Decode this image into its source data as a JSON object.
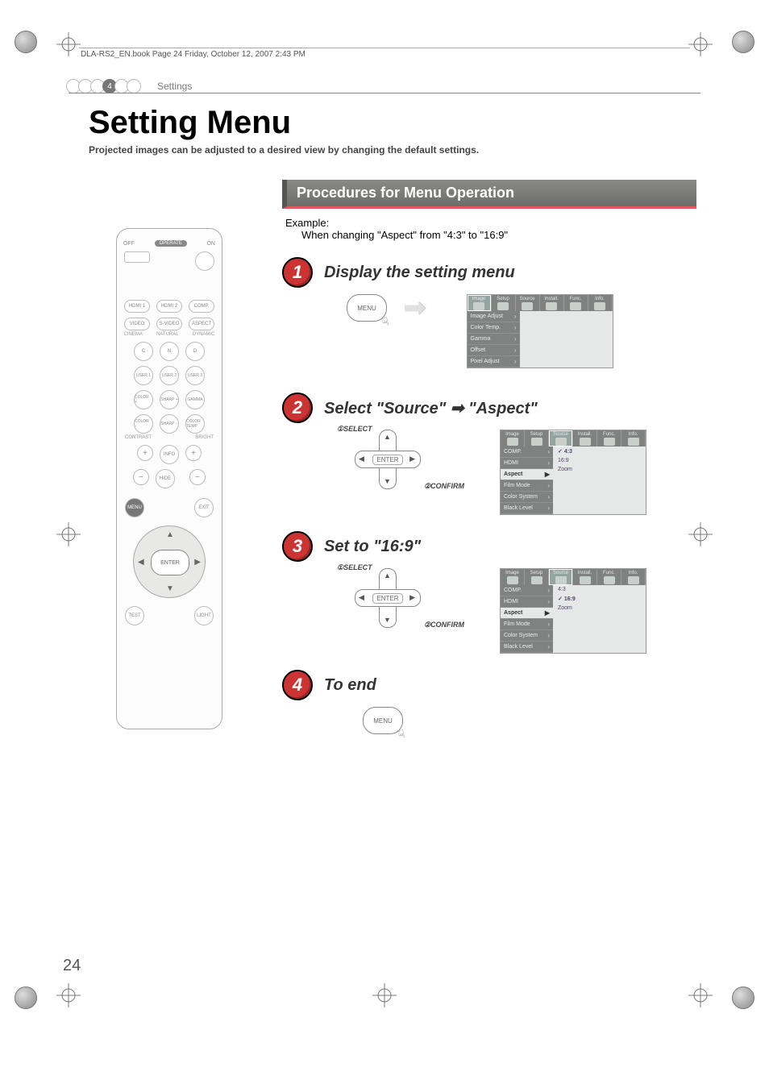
{
  "book_header": "DLA-RS2_EN.book  Page 24  Friday, October 12, 2007  2:43 PM",
  "breadcrumb": {
    "active_index": "4",
    "label": "Settings"
  },
  "title": "Setting Menu",
  "subtitle": "Projected images can be adjusted to a desired view by changing the default settings.",
  "section_header": "Procedures for Menu Operation",
  "example": {
    "label": "Example:",
    "desc": "When changing \"Aspect\" from \"4:3\" to \"16:9\""
  },
  "steps": [
    {
      "num": "1",
      "title": "Display the setting menu"
    },
    {
      "num": "2",
      "title": "Select \"Source\" ➡ \"Aspect\""
    },
    {
      "num": "3",
      "title": "Set to \"16:9\""
    },
    {
      "num": "4",
      "title": "To end"
    }
  ],
  "labels": {
    "menu": "MENU",
    "enter": "ENTER",
    "select": "①SELECT",
    "confirm": "②CONFIRM"
  },
  "remote": {
    "off": "OFF",
    "operate": "OPERATE",
    "on": "ON",
    "row1": [
      "HDMI 1",
      "HDMI 2",
      "COMP."
    ],
    "row2": [
      "VIDEO",
      "S-VIDEO",
      "ASPECT"
    ],
    "row2_labels": [
      "CINEMA",
      "NATURAL",
      "DYNAMIC"
    ],
    "row3": [
      "C",
      "N",
      "D"
    ],
    "row4": [
      "USER 1",
      "USER 2",
      "USER 3"
    ],
    "row5": [
      "COLOR +",
      "SHARP +",
      "GAMMA"
    ],
    "row6": [
      "COLOR −",
      "SHARP −",
      "COLOR TEMP"
    ],
    "contrast": "CONTRAST",
    "bright": "BRIGHT",
    "info": "INFO",
    "hide": "HIDE",
    "menu": "MENU",
    "exit": "EXIT",
    "enter": "ENTER",
    "test": "TEST",
    "light": "LIGHT"
  },
  "osd_tabs": [
    "Image",
    "Setup",
    "Source",
    "Install.",
    "Func.",
    "Info."
  ],
  "osd1_items": [
    "Image Adjust",
    "Color Temp.",
    "Gamma",
    "Offset",
    "Pixel Adjust"
  ],
  "osd2": {
    "items": [
      "COMP.",
      "HDMI",
      "Aspect",
      "Film Mode",
      "Color System",
      "Black Level"
    ],
    "options": [
      "4:3",
      "16:9",
      "Zoom"
    ],
    "selected_option": "4:3"
  },
  "osd3": {
    "items": [
      "COMP.",
      "HDMI",
      "Aspect",
      "Film Mode",
      "Color System",
      "Black Level"
    ],
    "options": [
      "4:3",
      "16:9",
      "Zoom"
    ],
    "selected_option": "16:9"
  },
  "page_number": "24"
}
